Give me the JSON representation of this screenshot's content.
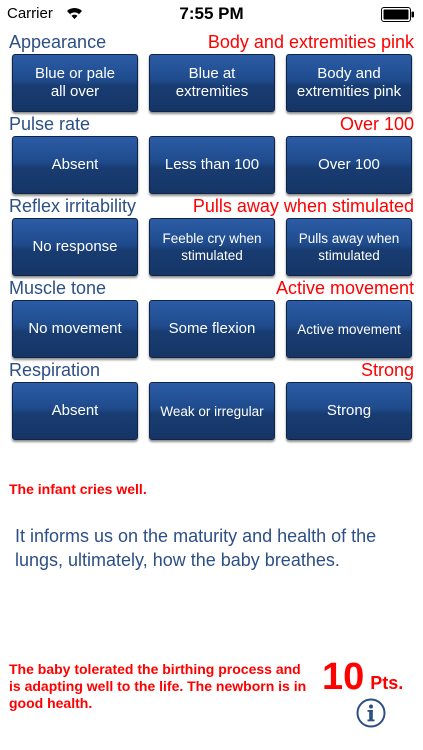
{
  "status_bar": {
    "carrier": "Carrier",
    "time": "7:55 PM"
  },
  "sections": [
    {
      "title": "Appearance",
      "value": "Body and extremities pink",
      "options": [
        "Blue or pale\nall over",
        "Blue at\nextremities",
        "Body and\nextremities pink"
      ]
    },
    {
      "title": "Pulse rate",
      "value": "Over 100",
      "options": [
        "Absent",
        "Less than 100",
        "Over 100"
      ]
    },
    {
      "title": "Reflex irritability",
      "value": "Pulls away when stimulated",
      "options": [
        "No response",
        "Feeble cry when\nstimulated",
        "Pulls away when\nstimulated"
      ]
    },
    {
      "title": "Muscle tone",
      "value": "Active movement",
      "options": [
        "No movement",
        "Some flexion",
        "Active movement"
      ]
    },
    {
      "title": "Respiration",
      "value": "Strong",
      "options": [
        "Absent",
        "Weak or irregular",
        "Strong"
      ]
    }
  ],
  "hint": "The infant cries well.",
  "info": "It informs us on the maturity and health of the lungs, ultimately, how the baby breathes.",
  "summary": "The baby tolerated the birthing process and is adapting well to the life. The newborn is in good health.",
  "score": {
    "value": "10",
    "unit": "Pts."
  },
  "colors": {
    "accent_red": "#ff0000",
    "title_blue": "#2c4f86",
    "button_blue": "#1f4b8c"
  }
}
